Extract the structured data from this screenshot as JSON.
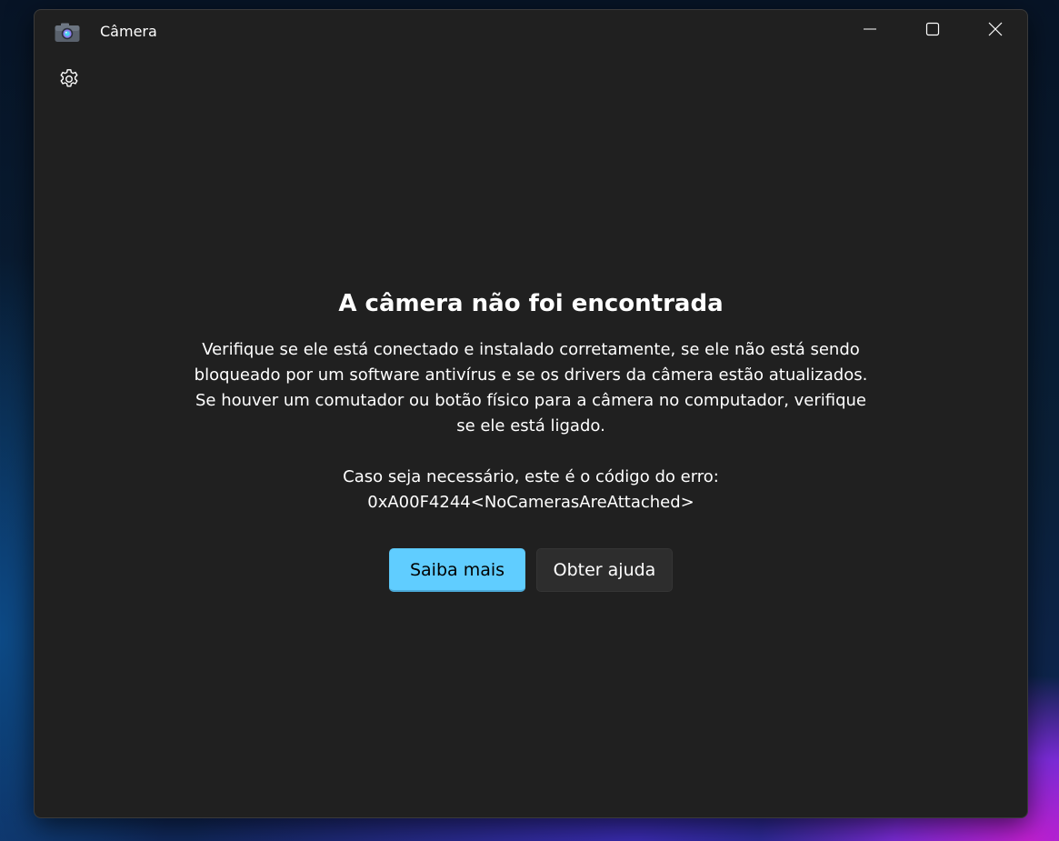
{
  "window": {
    "title": "Câmera",
    "controls": {
      "minimize": "minimize-icon",
      "maximize": "maximize-icon",
      "close": "close-icon"
    }
  },
  "toolbar": {
    "settings_icon": "gear-icon"
  },
  "error": {
    "heading": "A câmera não foi encontrada",
    "description": "Verifique se ele está conectado e instalado corretamente, se ele não está sendo bloqueado por um software antivírus e se os drivers da câmera estão atualizados. Se houver um comutador ou botão físico para a câmera no computador, verifique se ele está ligado.",
    "code_intro": "Caso seja necessário, este é o código do erro:",
    "code": "0xA00F4244<NoCamerasAreAttached>"
  },
  "actions": {
    "learn_more": "Saiba mais",
    "get_help": "Obter ajuda"
  },
  "colors": {
    "accent": "#60cdff",
    "window_bg": "#202020"
  }
}
